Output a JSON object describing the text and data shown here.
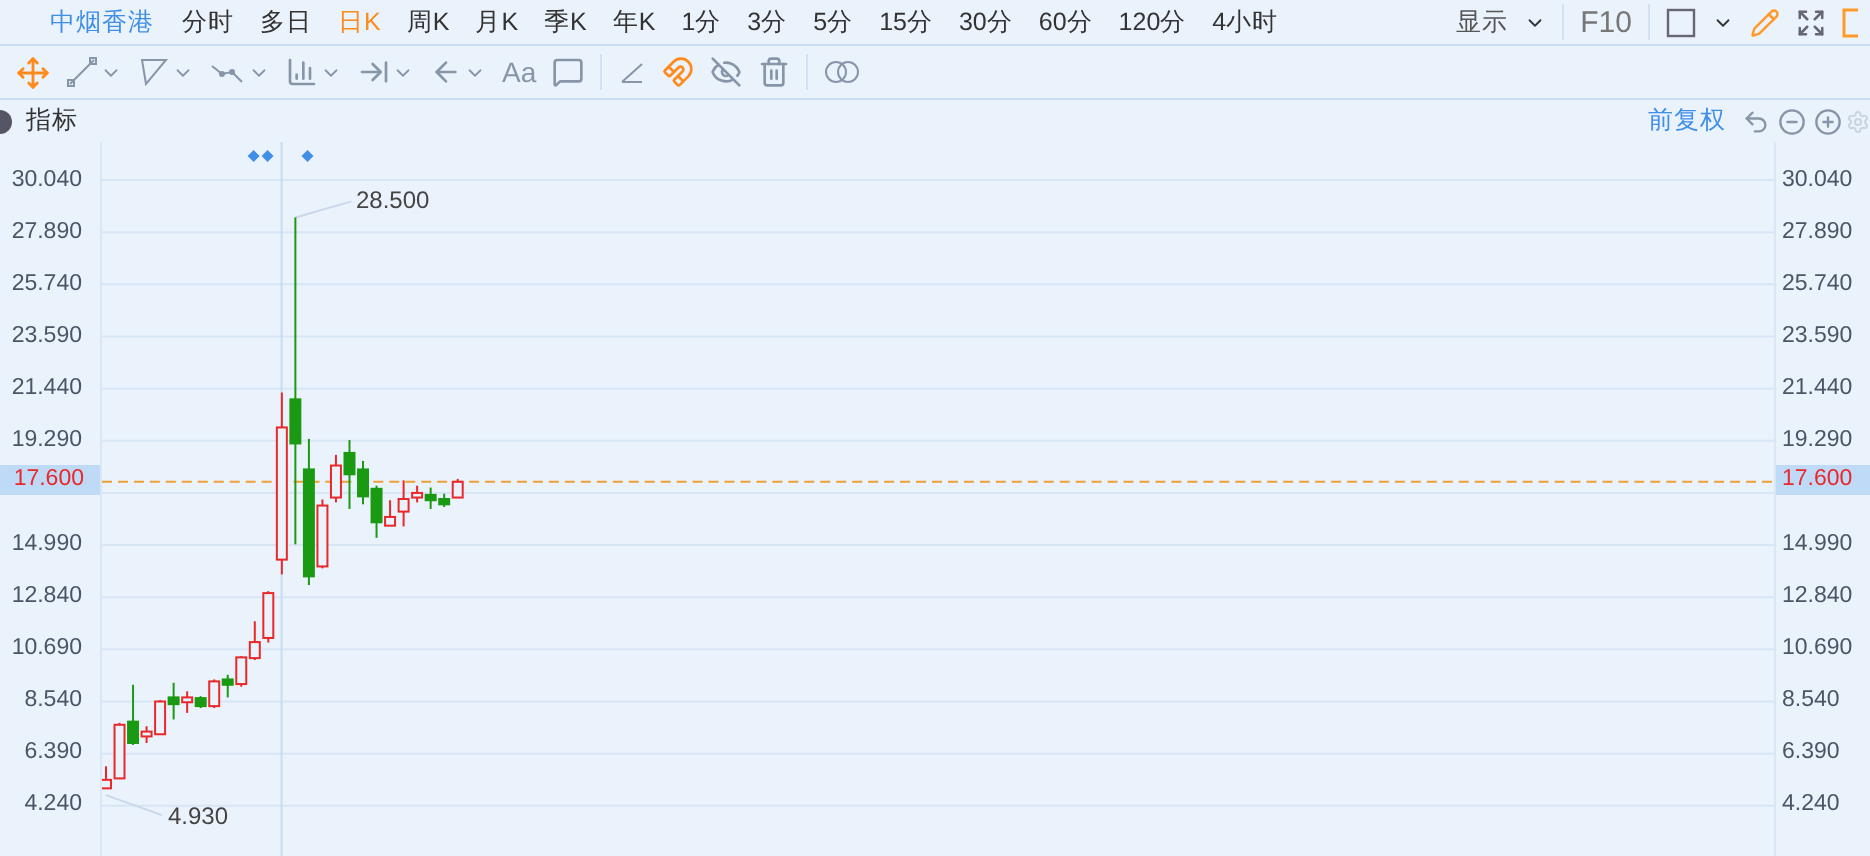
{
  "stock_name": "中烟香港",
  "periods": [
    {
      "label": "分时",
      "selected": false
    },
    {
      "label": "多日",
      "selected": false
    },
    {
      "label": "日K",
      "selected": true
    },
    {
      "label": "周K",
      "selected": false
    },
    {
      "label": "月K",
      "selected": false
    },
    {
      "label": "季K",
      "selected": false
    },
    {
      "label": "年K",
      "selected": false
    },
    {
      "label": "1分",
      "selected": false
    },
    {
      "label": "3分",
      "selected": false
    },
    {
      "label": "5分",
      "selected": false
    },
    {
      "label": "15分",
      "selected": false
    },
    {
      "label": "30分",
      "selected": false
    },
    {
      "label": "60分",
      "selected": false
    },
    {
      "label": "120分",
      "selected": false
    },
    {
      "label": "4小时",
      "selected": false
    }
  ],
  "display_menu": "显示",
  "f10": "F10",
  "text_tool": "Aa",
  "indicator_label": "指标",
  "adjustment": "前复权",
  "right_axis": {
    "ticks": [
      "30.040",
      "27.890",
      "25.740",
      "23.590",
      "21.440",
      "19.290",
      "14.990",
      "12.840",
      "10.690",
      "8.540",
      "6.390",
      "4.240"
    ],
    "current_price": "17.600"
  },
  "annotations": {
    "high": "28.500",
    "low": "4.930"
  },
  "chart_data": {
    "type": "candlestick",
    "grid": true,
    "ylim": [
      2.17,
      31.61
    ],
    "ref_lines": [
      {
        "axis": "y",
        "value": 17.6,
        "label": "17.600",
        "color": "#f0a030"
      }
    ],
    "ohlc": [
      [
        4.96,
        5.87,
        4.93,
        5.31
      ],
      [
        5.37,
        7.66,
        5.37,
        7.58
      ],
      [
        7.71,
        9.23,
        6.75,
        6.83
      ],
      [
        7.1,
        7.52,
        6.83,
        7.3
      ],
      [
        7.19,
        8.6,
        7.16,
        8.54
      ],
      [
        8.71,
        9.31,
        7.8,
        8.43
      ],
      [
        8.51,
        8.96,
        8.07,
        8.71
      ],
      [
        8.68,
        8.76,
        8.27,
        8.35
      ],
      [
        8.35,
        9.45,
        8.27,
        9.37
      ],
      [
        9.45,
        9.64,
        8.71,
        9.23
      ],
      [
        9.26,
        10.41,
        9.15,
        10.36
      ],
      [
        10.33,
        11.85,
        10.25,
        10.99
      ],
      [
        11.16,
        13.09,
        10.97,
        13.01
      ],
      [
        14.39,
        21.28,
        13.78,
        19.84
      ],
      [
        21.0,
        28.5,
        15.02,
        19.18
      ],
      [
        18.11,
        19.37,
        13.34,
        13.7
      ],
      [
        14.11,
        16.87,
        14.03,
        16.62
      ],
      [
        16.95,
        18.71,
        16.75,
        18.27
      ],
      [
        18.79,
        19.32,
        16.48,
        17.91
      ],
      [
        18.11,
        18.46,
        16.67,
        17.0
      ],
      [
        17.31,
        17.44,
        15.29,
        15.93
      ],
      [
        15.79,
        16.84,
        15.79,
        16.15
      ],
      [
        16.37,
        17.66,
        15.76,
        16.89
      ],
      [
        16.95,
        17.44,
        16.75,
        17.14
      ],
      [
        17.06,
        17.36,
        16.48,
        16.84
      ],
      [
        16.89,
        17.11,
        16.56,
        16.67
      ],
      [
        16.95,
        17.72,
        16.95,
        17.6
      ]
    ],
    "yticks": [
      {
        "value": 30.04,
        "label": "30.040"
      },
      {
        "value": 27.89,
        "label": "27.890"
      },
      {
        "value": 25.74,
        "label": "25.740"
      },
      {
        "value": 23.59,
        "label": "23.590"
      },
      {
        "value": 21.44,
        "label": "21.440"
      },
      {
        "value": 19.29,
        "label": "19.290"
      },
      {
        "value": 14.99,
        "label": "14.990"
      },
      {
        "value": 12.84,
        "label": "12.840"
      },
      {
        "value": 10.69,
        "label": "10.690"
      },
      {
        "value": 8.54,
        "label": "8.540"
      },
      {
        "value": 6.39,
        "label": "6.390"
      },
      {
        "value": 4.24,
        "label": "4.240"
      }
    ]
  }
}
